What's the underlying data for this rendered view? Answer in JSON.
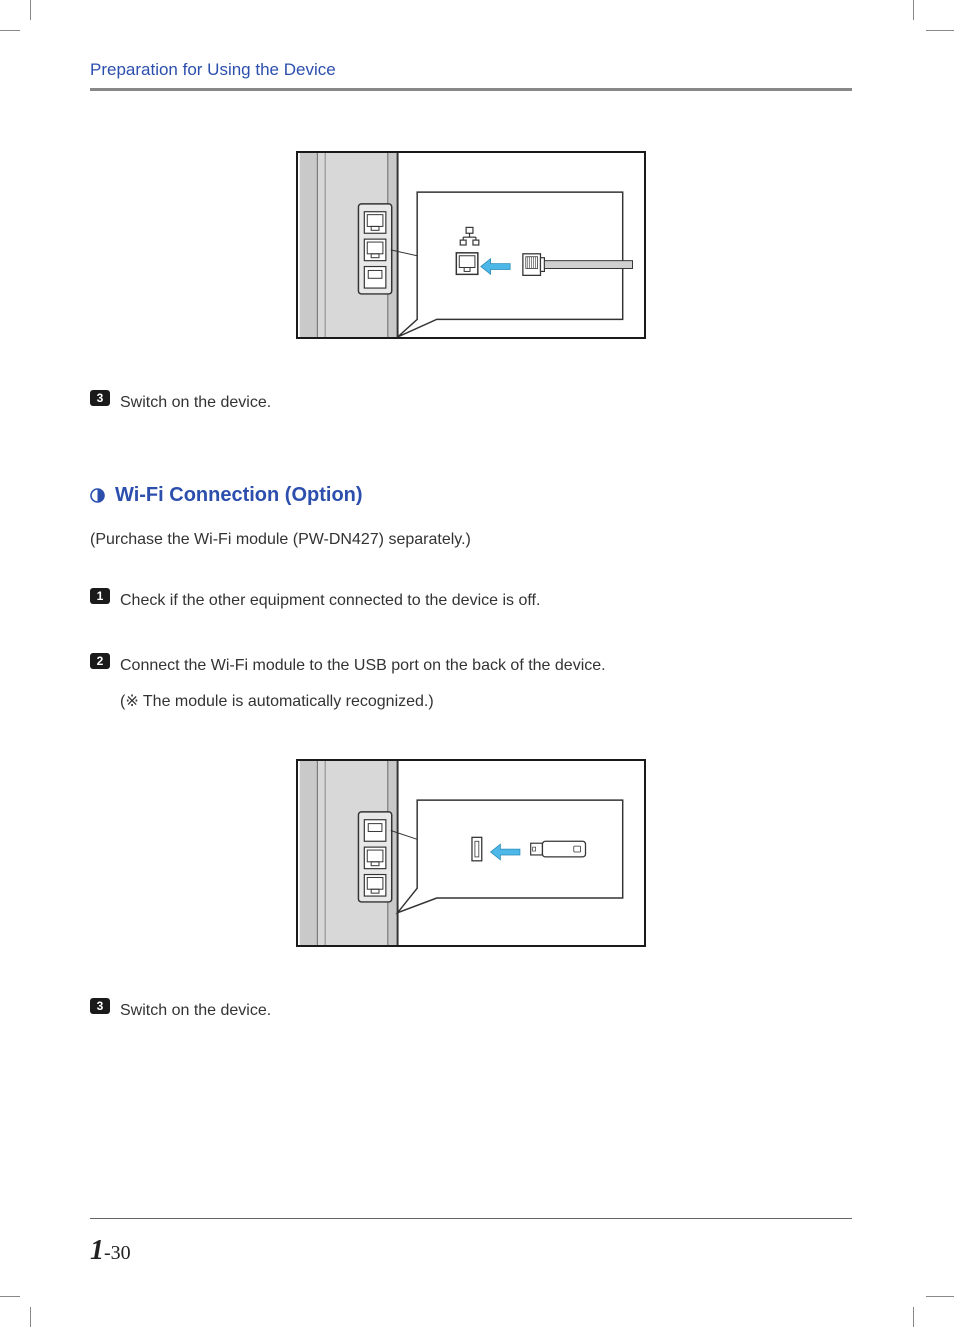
{
  "header": {
    "section_title": "Preparation for Using the Device"
  },
  "first_steps": {
    "step3_badge": "3",
    "step3_text": "Switch on the device."
  },
  "wifi_section": {
    "heading": "Wi-Fi Connection (Option)",
    "note": "(Purchase the Wi-Fi module (PW-DN427) separately.)",
    "step1_badge": "1",
    "step1_text": "Check if the other equipment connected to the device is off.",
    "step2_badge": "2",
    "step2_text": "Connect the Wi-Fi module to the USB port on the back of the device.",
    "step2_sub": "(※ The module is automatically recognized.)",
    "step3_badge": "3",
    "step3_text": "Switch on the device."
  },
  "footer": {
    "chapter": "1",
    "page": "-30"
  }
}
